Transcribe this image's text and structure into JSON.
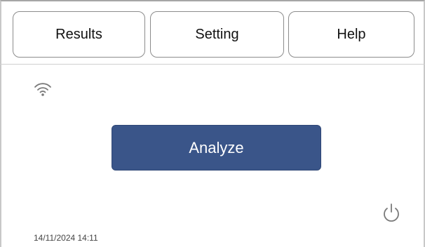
{
  "tabs": {
    "results_label": "Results",
    "setting_label": "Setting",
    "help_label": "Help"
  },
  "icons": {
    "wifi": "wifi-icon",
    "power": "power-icon"
  },
  "main": {
    "analyze_label": "Analyze"
  },
  "status": {
    "timestamp": "14/11/2024 14:11"
  },
  "colors": {
    "analyze_button": "#3a5589",
    "icon_gray": "#7a7a7a"
  }
}
